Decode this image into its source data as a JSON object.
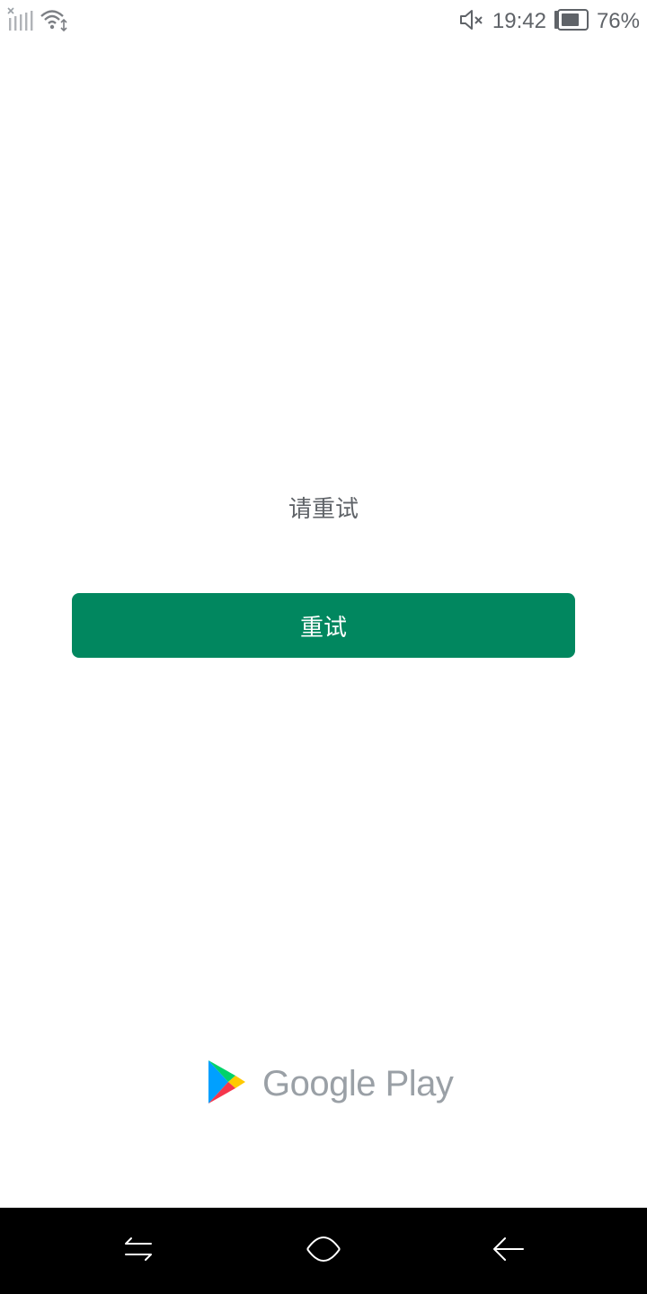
{
  "status_bar": {
    "time": "19:42",
    "battery_percent": "76%",
    "battery_level": 0.76,
    "icons": [
      "signal-off-icon",
      "wifi-icon",
      "mute-icon",
      "battery-icon"
    ]
  },
  "main": {
    "message": "请重试",
    "retry_button_label": "重试"
  },
  "brand": {
    "text": "Google Play"
  },
  "nav": {
    "buttons": [
      "recents-icon",
      "home-icon",
      "back-icon"
    ]
  },
  "colors": {
    "accent": "#01875f",
    "text_secondary": "#5f6368",
    "logo_text": "#9aa0a6",
    "nav_background": "#000000"
  }
}
